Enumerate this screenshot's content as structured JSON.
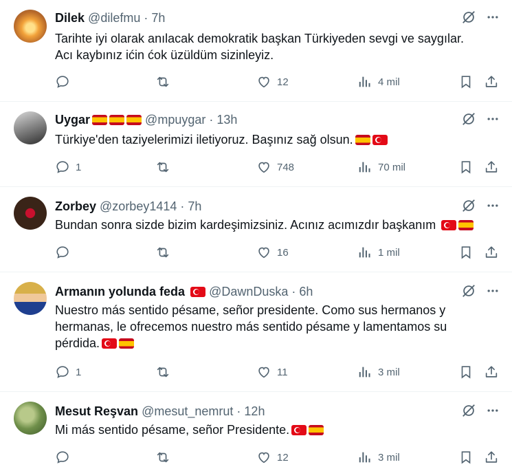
{
  "tweets": [
    {
      "name": "Dilek",
      "flags": [],
      "handle": "@dilefmu",
      "time": "7h",
      "lines": [
        "Tarihte iyi olarak anılacak demokratik başkan Türkiyeden sevgi ve saygılar.",
        "Acı kaybınız ićin ćok üzüldüm sizinleyiz."
      ],
      "body_flags": [],
      "replies": "",
      "likes": "12",
      "views": "4 mil"
    },
    {
      "name": "Uygar",
      "flags": [
        "es",
        "es",
        "es"
      ],
      "handle": "@mpuygar",
      "time": "13h",
      "lines": [
        "Türkiye'den taziyelerimizi iletiyoruz. Başınız sağ olsun."
      ],
      "body_flags": [
        "es",
        "tr"
      ],
      "replies": "1",
      "likes": "748",
      "views": "70 mil"
    },
    {
      "name": "Zorbey",
      "flags": [],
      "handle": "@zorbey1414",
      "time": "7h",
      "lines": [
        "Bundan sonra sizde bizim kardeşimizsiniz. Acınız acımızdır başkanım"
      ],
      "body_flags": [
        "tr",
        "es"
      ],
      "replies": "",
      "likes": "16",
      "views": "1 mil"
    },
    {
      "name": "Armanın yolunda feda",
      "flags": [
        "tr"
      ],
      "handle": "@DawnDuska",
      "time": "6h",
      "lines": [
        "Nuestro más sentido pésame, señor presidente. Como sus hermanos y",
        "hermanas, le ofrecemos nuestro más sentido pésame y lamentamos su",
        "pérdida."
      ],
      "body_flags": [
        "tr",
        "es"
      ],
      "replies": "1",
      "likes": "11",
      "views": "3 mil"
    },
    {
      "name": "Mesut Reşvan",
      "flags": [],
      "handle": "@mesut_nemrut",
      "time": "12h",
      "lines": [
        "Mi más sentido pésame, señor Presidente."
      ],
      "body_flags": [
        "tr",
        "es"
      ],
      "replies": "",
      "likes": "12",
      "views": "3 mil"
    }
  ],
  "separator": "·",
  "icons": {
    "grok": "grok-icon",
    "more": "more-icon",
    "reply": "reply-icon",
    "retweet": "retweet-icon",
    "like": "like-icon",
    "views": "views-icon",
    "bookmark": "bookmark-icon",
    "share": "share-icon"
  }
}
